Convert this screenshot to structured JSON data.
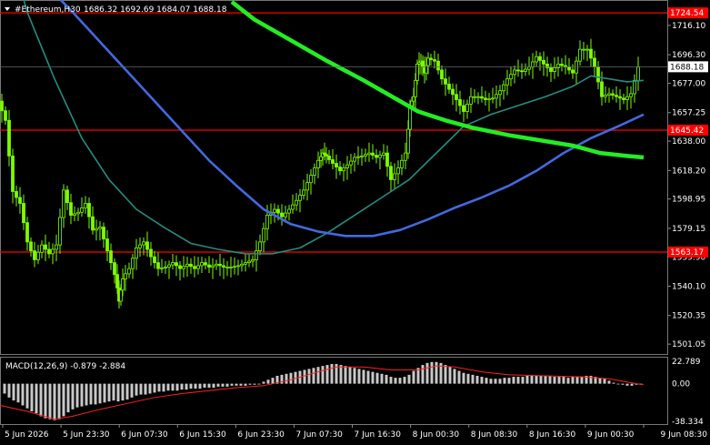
{
  "header": {
    "symbol_text": "#Ethereum,H30",
    "ohlc_text": "1686.32 1692.69 1684.07 1688.18",
    "indicator_text": "MACD(12,26,9)  -0.879  -2.884"
  },
  "colors": {
    "background": "#000000",
    "grid": "#3a3a3a",
    "candle": "#7cfc00",
    "ma_fast": "#1f8f84",
    "ma_mid": "#4169e1",
    "ma_slow": "#22ee22",
    "level_line": "#ff0000",
    "macd_hist": "#c8c8c8",
    "macd_signal": "#ff2020",
    "axis_text": "#ffffff"
  },
  "chart_data": {
    "type": "line",
    "title": "#Ethereum,H30",
    "price_axis": {
      "ylim": [
        1495.0,
        1732.0
      ],
      "ticks": [
        "1716.10",
        "1696.30",
        "1677.00",
        "1657.25",
        "1638.00",
        "1618.20",
        "1598.95",
        "1579.15",
        "1559.90",
        "1540.10",
        "1520.35",
        "1501.05"
      ]
    },
    "current_price": "1688.18",
    "level_lines": [
      {
        "value": 1724.54,
        "label": "1724.54"
      },
      {
        "value": 1645.42,
        "label": "1645.42"
      },
      {
        "value": 1563.17,
        "label": "1563.17"
      }
    ],
    "x_labels": [
      "5 Jun 2026",
      "5 Jun 23:30",
      "6 Jun 07:30",
      "6 Jun 15:30",
      "6 Jun 23:30",
      "7 Jun 07:30",
      "7 Jun 16:30",
      "8 Jun 00:30",
      "8 Jun 08:30",
      "8 Jun 16:30",
      "9 Jun 00:30",
      "9 Jun 08:30"
    ],
    "price_series": {
      "name": "close",
      "points": [
        [
          0,
          1665
        ],
        [
          8,
          1652
        ],
        [
          16,
          1604
        ],
        [
          24,
          1596
        ],
        [
          32,
          1570
        ],
        [
          40,
          1558
        ],
        [
          48,
          1568
        ],
        [
          56,
          1562
        ],
        [
          64,
          1568
        ],
        [
          72,
          1605
        ],
        [
          80,
          1588
        ],
        [
          88,
          1590
        ],
        [
          96,
          1596
        ],
        [
          104,
          1578
        ],
        [
          112,
          1580
        ],
        [
          120,
          1564
        ],
        [
          128,
          1548
        ],
        [
          132,
          1530
        ],
        [
          136,
          1545
        ],
        [
          144,
          1552
        ],
        [
          152,
          1566
        ],
        [
          160,
          1570
        ],
        [
          168,
          1560
        ],
        [
          176,
          1552
        ],
        [
          184,
          1553
        ],
        [
          192,
          1556
        ],
        [
          200,
          1552
        ],
        [
          208,
          1555
        ],
        [
          216,
          1552
        ],
        [
          224,
          1556
        ],
        [
          232,
          1553
        ],
        [
          240,
          1555
        ],
        [
          248,
          1553
        ],
        [
          256,
          1553
        ],
        [
          264,
          1554
        ],
        [
          272,
          1556
        ],
        [
          280,
          1558
        ],
        [
          288,
          1570
        ],
        [
          296,
          1588
        ],
        [
          304,
          1592
        ],
        [
          312,
          1587
        ],
        [
          320,
          1592
        ],
        [
          328,
          1598
        ],
        [
          336,
          1605
        ],
        [
          344,
          1615
        ],
        [
          352,
          1625
        ],
        [
          356,
          1630
        ],
        [
          360,
          1628
        ],
        [
          368,
          1623
        ],
        [
          376,
          1618
        ],
        [
          384,
          1622
        ],
        [
          392,
          1627
        ],
        [
          400,
          1628
        ],
        [
          408,
          1630
        ],
        [
          416,
          1627
        ],
        [
          424,
          1630
        ],
        [
          432,
          1612
        ],
        [
          440,
          1620
        ],
        [
          448,
          1630
        ],
        [
          452,
          1662
        ],
        [
          456,
          1668
        ],
        [
          460,
          1690
        ],
        [
          464,
          1692
        ],
        [
          468,
          1684
        ],
        [
          472,
          1694
        ],
        [
          480,
          1692
        ],
        [
          488,
          1680
        ],
        [
          496,
          1673
        ],
        [
          504,
          1666
        ],
        [
          512,
          1658
        ],
        [
          520,
          1668
        ],
        [
          528,
          1668
        ],
        [
          536,
          1666
        ],
        [
          544,
          1667
        ],
        [
          552,
          1672
        ],
        [
          560,
          1680
        ],
        [
          568,
          1686
        ],
        [
          576,
          1685
        ],
        [
          584,
          1688
        ],
        [
          592,
          1695
        ],
        [
          600,
          1690
        ],
        [
          608,
          1685
        ],
        [
          616,
          1690
        ],
        [
          624,
          1688
        ],
        [
          632,
          1684
        ],
        [
          640,
          1700
        ],
        [
          648,
          1700
        ],
        [
          656,
          1688
        ],
        [
          664,
          1668
        ],
        [
          672,
          1670
        ],
        [
          680,
          1668
        ],
        [
          688,
          1666
        ],
        [
          696,
          1670
        ],
        [
          704,
          1688
        ]
      ]
    },
    "series": [
      {
        "name": "ma_fast",
        "points": [
          [
            0,
            1790
          ],
          [
            30,
            1725
          ],
          [
            60,
            1680
          ],
          [
            90,
            1640
          ],
          [
            120,
            1612
          ],
          [
            150,
            1592
          ],
          [
            180,
            1580
          ],
          [
            210,
            1569
          ],
          [
            240,
            1565
          ],
          [
            270,
            1562
          ],
          [
            300,
            1562
          ],
          [
            330,
            1566
          ],
          [
            360,
            1576
          ],
          [
            390,
            1588
          ],
          [
            420,
            1600
          ],
          [
            450,
            1612
          ],
          [
            480,
            1630
          ],
          [
            510,
            1648
          ],
          [
            540,
            1656
          ],
          [
            570,
            1662
          ],
          [
            600,
            1668
          ],
          [
            630,
            1675
          ],
          [
            650,
            1682
          ],
          [
            670,
            1680
          ],
          [
            690,
            1678
          ],
          [
            708,
            1679
          ]
        ]
      },
      {
        "name": "ma_mid",
        "points": [
          [
            0,
            1780
          ],
          [
            40,
            1750
          ],
          [
            80,
            1725
          ],
          [
            110,
            1705
          ],
          [
            140,
            1685
          ],
          [
            170,
            1665
          ],
          [
            200,
            1645
          ],
          [
            230,
            1625
          ],
          [
            260,
            1608
          ],
          [
            290,
            1592
          ],
          [
            320,
            1582
          ],
          [
            350,
            1577
          ],
          [
            380,
            1574
          ],
          [
            410,
            1574
          ],
          [
            440,
            1578
          ],
          [
            470,
            1585
          ],
          [
            500,
            1593
          ],
          [
            530,
            1600
          ],
          [
            560,
            1608
          ],
          [
            590,
            1618
          ],
          [
            620,
            1630
          ],
          [
            650,
            1640
          ],
          [
            680,
            1648
          ],
          [
            708,
            1656
          ]
        ]
      },
      {
        "name": "ma_slow",
        "points": [
          [
            255,
            1732
          ],
          [
            280,
            1720
          ],
          [
            320,
            1706
          ],
          [
            360,
            1692
          ],
          [
            400,
            1679
          ],
          [
            440,
            1665
          ],
          [
            460,
            1658
          ],
          [
            490,
            1652
          ],
          [
            520,
            1647
          ],
          [
            560,
            1642
          ],
          [
            600,
            1638
          ],
          [
            630,
            1635
          ],
          [
            660,
            1630
          ],
          [
            690,
            1628
          ],
          [
            708,
            1627
          ]
        ]
      }
    ],
    "macd": {
      "label": "MACD(12,26,9)",
      "main": "-0.879",
      "signal": "-2.884",
      "ylim": [
        -40.0,
        25.5
      ],
      "ticks": [
        "22.789",
        "0.00",
        "-38.334"
      ],
      "hist": [
        [
          5,
          -10
        ],
        [
          10,
          -14
        ],
        [
          15,
          -17
        ],
        [
          20,
          -19
        ],
        [
          25,
          -22
        ],
        [
          30,
          -25
        ],
        [
          35,
          -28
        ],
        [
          40,
          -30
        ],
        [
          45,
          -33
        ],
        [
          50,
          -35
        ],
        [
          55,
          -36
        ],
        [
          60,
          -37
        ],
        [
          65,
          -36
        ],
        [
          70,
          -33
        ],
        [
          75,
          -29
        ],
        [
          80,
          -26
        ],
        [
          85,
          -24
        ],
        [
          90,
          -23
        ],
        [
          95,
          -22
        ],
        [
          100,
          -21
        ],
        [
          105,
          -21
        ],
        [
          110,
          -20
        ],
        [
          115,
          -19
        ],
        [
          120,
          -18
        ],
        [
          125,
          -17
        ],
        [
          130,
          -18
        ],
        [
          135,
          -17
        ],
        [
          140,
          -16
        ],
        [
          145,
          -14
        ],
        [
          150,
          -12
        ],
        [
          155,
          -11
        ],
        [
          160,
          -11
        ],
        [
          165,
          -10
        ],
        [
          170,
          -9
        ],
        [
          175,
          -8
        ],
        [
          180,
          -8
        ],
        [
          185,
          -7
        ],
        [
          190,
          -7
        ],
        [
          195,
          -7
        ],
        [
          200,
          -6
        ],
        [
          205,
          -6
        ],
        [
          210,
          -5
        ],
        [
          215,
          -5
        ],
        [
          220,
          -5
        ],
        [
          225,
          -4
        ],
        [
          230,
          -4
        ],
        [
          235,
          -4
        ],
        [
          240,
          -3
        ],
        [
          245,
          -3
        ],
        [
          250,
          -3
        ],
        [
          255,
          -2
        ],
        [
          260,
          -2
        ],
        [
          265,
          -2
        ],
        [
          270,
          -2
        ],
        [
          275,
          -1
        ],
        [
          280,
          -1
        ],
        [
          285,
          0
        ],
        [
          290,
          2
        ],
        [
          295,
          4
        ],
        [
          300,
          6
        ],
        [
          305,
          8
        ],
        [
          310,
          9
        ],
        [
          315,
          10
        ],
        [
          320,
          11
        ],
        [
          325,
          12
        ],
        [
          330,
          13
        ],
        [
          335,
          14
        ],
        [
          340,
          15
        ],
        [
          345,
          16
        ],
        [
          350,
          17
        ],
        [
          355,
          18
        ],
        [
          360,
          19
        ],
        [
          365,
          20
        ],
        [
          370,
          20
        ],
        [
          375,
          19
        ],
        [
          380,
          18
        ],
        [
          385,
          17
        ],
        [
          390,
          16
        ],
        [
          395,
          15
        ],
        [
          400,
          14
        ],
        [
          405,
          13
        ],
        [
          410,
          12
        ],
        [
          415,
          11
        ],
        [
          420,
          10
        ],
        [
          425,
          9
        ],
        [
          430,
          7
        ],
        [
          435,
          6
        ],
        [
          440,
          6
        ],
        [
          445,
          7
        ],
        [
          450,
          9
        ],
        [
          455,
          13
        ],
        [
          460,
          16
        ],
        [
          465,
          19
        ],
        [
          470,
          21
        ],
        [
          475,
          22
        ],
        [
          480,
          22
        ],
        [
          485,
          21
        ],
        [
          490,
          19
        ],
        [
          495,
          17
        ],
        [
          500,
          15
        ],
        [
          505,
          13
        ],
        [
          510,
          11
        ],
        [
          515,
          10
        ],
        [
          520,
          9
        ],
        [
          525,
          8
        ],
        [
          530,
          7
        ],
        [
          535,
          6
        ],
        [
          540,
          5
        ],
        [
          545,
          5
        ],
        [
          550,
          5
        ],
        [
          555,
          6
        ],
        [
          560,
          6
        ],
        [
          565,
          7
        ],
        [
          570,
          7
        ],
        [
          575,
          7
        ],
        [
          580,
          8
        ],
        [
          585,
          8
        ],
        [
          590,
          8
        ],
        [
          595,
          8
        ],
        [
          600,
          8
        ],
        [
          605,
          8
        ],
        [
          610,
          7
        ],
        [
          615,
          7
        ],
        [
          620,
          7
        ],
        [
          625,
          6
        ],
        [
          630,
          7
        ],
        [
          635,
          7
        ],
        [
          640,
          7
        ],
        [
          645,
          8
        ],
        [
          650,
          8
        ],
        [
          655,
          7
        ],
        [
          660,
          6
        ],
        [
          665,
          5
        ],
        [
          670,
          3
        ],
        [
          675,
          1
        ],
        [
          680,
          0
        ],
        [
          685,
          -1
        ],
        [
          690,
          -2
        ],
        [
          695,
          -2
        ],
        [
          700,
          -1
        ],
        [
          705,
          -1
        ]
      ],
      "signal_points": [
        [
          0,
          -22
        ],
        [
          30,
          -28
        ],
        [
          60,
          -36
        ],
        [
          80,
          -33
        ],
        [
          110,
          -26
        ],
        [
          140,
          -20
        ],
        [
          170,
          -14
        ],
        [
          200,
          -10
        ],
        [
          230,
          -7
        ],
        [
          260,
          -4
        ],
        [
          290,
          -2
        ],
        [
          320,
          4
        ],
        [
          350,
          12
        ],
        [
          370,
          17
        ],
        [
          400,
          17
        ],
        [
          430,
          14
        ],
        [
          460,
          14
        ],
        [
          480,
          18
        ],
        [
          500,
          17
        ],
        [
          530,
          12
        ],
        [
          560,
          9
        ],
        [
          600,
          8
        ],
        [
          640,
          7
        ],
        [
          670,
          5
        ],
        [
          700,
          0
        ],
        [
          708,
          -1
        ]
      ]
    }
  }
}
